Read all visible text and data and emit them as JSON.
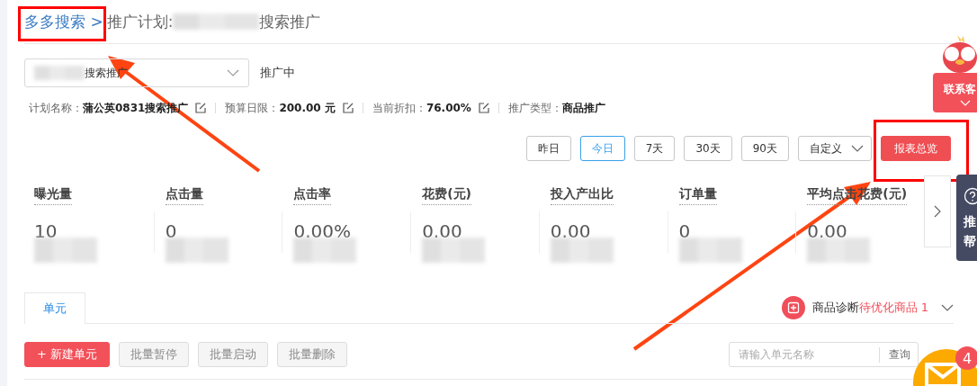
{
  "breadcrumb": {
    "root": "多多搜索 >",
    "prefix": "推广计划:",
    "suffix": "搜索推广"
  },
  "plan_selector": {
    "value": "搜索推广",
    "status": "推广中"
  },
  "plan_info": [
    {
      "label": "计划名称：",
      "value": "蒲公英0831搜索推广",
      "editable": true
    },
    {
      "label": "预算日限：",
      "value": "200.00 元",
      "editable": true
    },
    {
      "label": "当前折扣：",
      "value": "76.00%",
      "editable": true
    },
    {
      "label": "推广类型：",
      "value": "商品推广",
      "editable": false
    }
  ],
  "date_ranges": [
    {
      "label": "昨日",
      "selected": false
    },
    {
      "label": "今日",
      "selected": true
    },
    {
      "label": "7天",
      "selected": false
    },
    {
      "label": "30天",
      "selected": false
    },
    {
      "label": "90天",
      "selected": false
    }
  ],
  "custom_range": "自定义",
  "report_button": "报表总览",
  "metrics": [
    {
      "label": "曝光量",
      "value": "10"
    },
    {
      "label": "点击量",
      "value": "0"
    },
    {
      "label": "点击率",
      "value": "0.00%"
    },
    {
      "label": "花费(元)",
      "value": "0.00"
    },
    {
      "label": "投入产出比",
      "value": "0.00"
    },
    {
      "label": "订单量",
      "value": "0"
    },
    {
      "label": "平均点击花费(元)",
      "value": "0.00"
    }
  ],
  "support": {
    "contact": "联系客",
    "help_text": [
      "推",
      "帮"
    ]
  },
  "tabs": [
    {
      "label": "单元",
      "selected": true
    }
  ],
  "diagnosis": {
    "label": "商品诊断",
    "highlight": "待优化商品 1"
  },
  "actions": [
    {
      "label": "+ 新建单元",
      "kind": "primary"
    },
    {
      "label": "批量暂停",
      "kind": "secondary"
    },
    {
      "label": "批量启动",
      "kind": "secondary"
    },
    {
      "label": "批量删除",
      "kind": "secondary"
    }
  ],
  "search": {
    "placeholder": "请输入单元名称",
    "button": "查询"
  },
  "mail": {
    "badge": "4"
  }
}
